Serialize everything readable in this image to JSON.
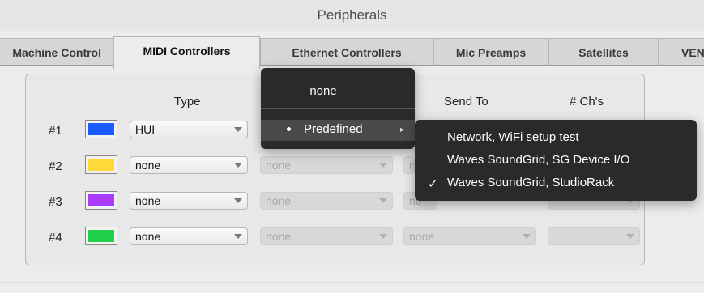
{
  "window": {
    "title": "Peripherals"
  },
  "tabs": [
    {
      "label": "Machine Control",
      "active": false
    },
    {
      "label": "MIDI Controllers",
      "active": true
    },
    {
      "label": "Ethernet Controllers",
      "active": false
    },
    {
      "label": "Mic Preamps",
      "active": false
    },
    {
      "label": "Satellites",
      "active": false
    },
    {
      "label": "VENUE",
      "active": false
    }
  ],
  "columns": {
    "type": "Type",
    "send_to": "Send To",
    "channels": "# Ch's"
  },
  "rows": [
    {
      "label": "#1",
      "color": "#1a5cff",
      "type": "HUI",
      "receive_from": "",
      "send_to": ""
    },
    {
      "label": "#2",
      "color": "#ffd93a",
      "type": "none",
      "receive_from": "none",
      "send_to": "n"
    },
    {
      "label": "#3",
      "color": "#a83bff",
      "type": "none",
      "receive_from": "none",
      "send_to": "no"
    },
    {
      "label": "#4",
      "color": "#22d14b",
      "type": "none",
      "receive_from": "none",
      "send_to": "none"
    }
  ],
  "popup_menu": {
    "items": [
      {
        "label": "none"
      },
      {
        "label": "Predefined",
        "highlighted": true,
        "has_submenu": true
      }
    ]
  },
  "submenu": {
    "items": [
      {
        "label": "Network, WiFi setup test",
        "checked": false
      },
      {
        "label": "Waves SoundGrid, SG Device I/O",
        "checked": false
      },
      {
        "label": "Waves SoundGrid, StudioRack",
        "checked": true
      }
    ],
    "check_glyph": "✓"
  }
}
